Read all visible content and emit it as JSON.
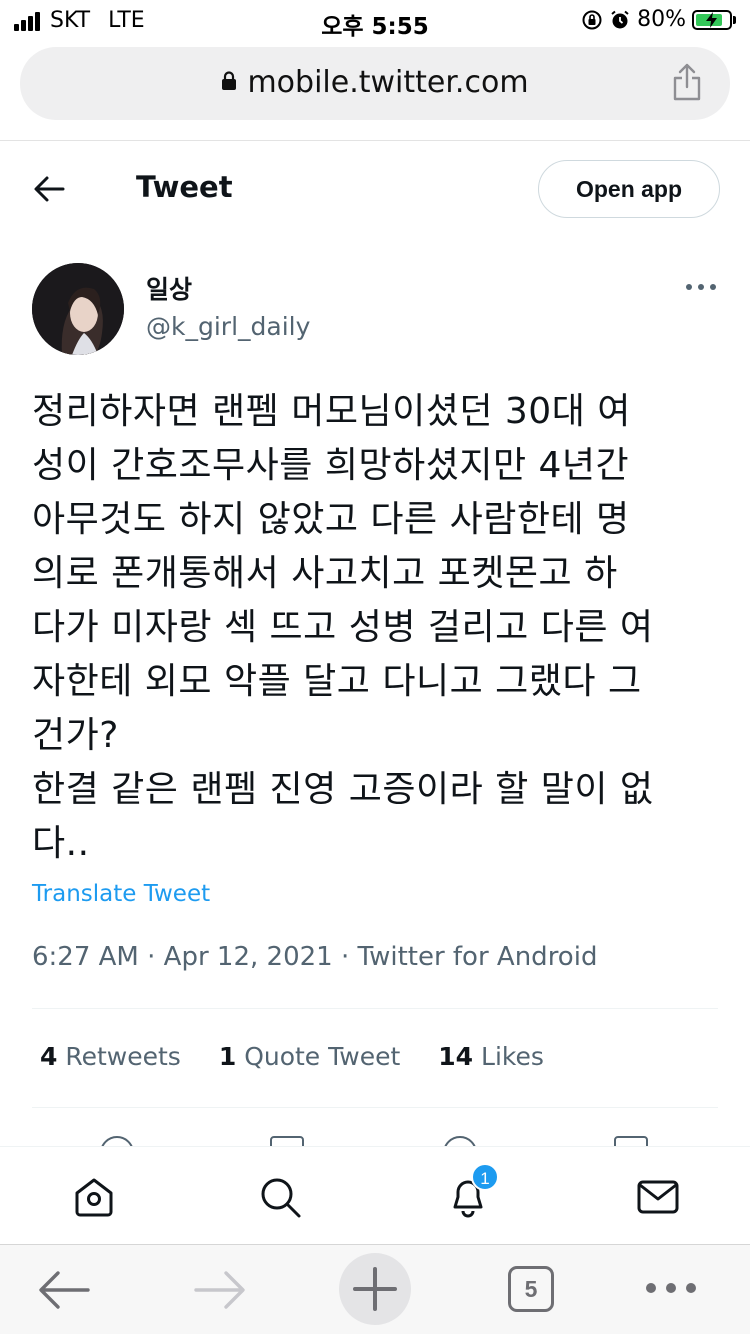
{
  "status_bar": {
    "carrier": "SKT",
    "network": "LTE",
    "time": "오후 5:55",
    "battery_percent": "80%",
    "battery_level": 0.8,
    "battery_color": "#34c759"
  },
  "browser": {
    "url": "mobile.twitter.com",
    "tab_count": "5"
  },
  "header": {
    "title": "Tweet",
    "open_app_label": "Open app"
  },
  "author": {
    "name": "일상",
    "handle": "@k_girl_daily"
  },
  "tweet": {
    "text": "정리하자면 랜펨 머모님이셨던 30대 여\n성이 간호조무사를 희망하셨지만 4년간\n아무것도 하지 않았고 다른 사람한테 명\n의로 폰개통해서 사고치고 포켓몬고 하\n다가 미자랑 섹 뜨고 성병 걸리고 다른 여\n자한테 외모 악플 달고 다니고 그랬다 그\n건가?\n한결 같은 랜펨 진영 고증이라 할 말이 없\n다..",
    "translate_label": "Translate Tweet",
    "time": "6:27 AM",
    "date": "Apr 12, 2021",
    "source": "Twitter for Android",
    "separator": "·"
  },
  "stats": {
    "retweets_count": "4",
    "retweets_label": "Retweets",
    "quotes_count": "1",
    "quotes_label": "Quote Tweet",
    "likes_count": "14",
    "likes_label": "Likes"
  },
  "twitter_nav": {
    "items": [
      "home-icon",
      "search-icon",
      "notifications-icon",
      "messages-icon"
    ],
    "notification_badge": "1",
    "accent_color": "#1d9bf0"
  },
  "safari_toolbar": {
    "items": [
      "back-arrow-icon",
      "forward-arrow-icon",
      "new-tab-plus-icon",
      "tabs-icon",
      "more-dots-icon"
    ]
  }
}
